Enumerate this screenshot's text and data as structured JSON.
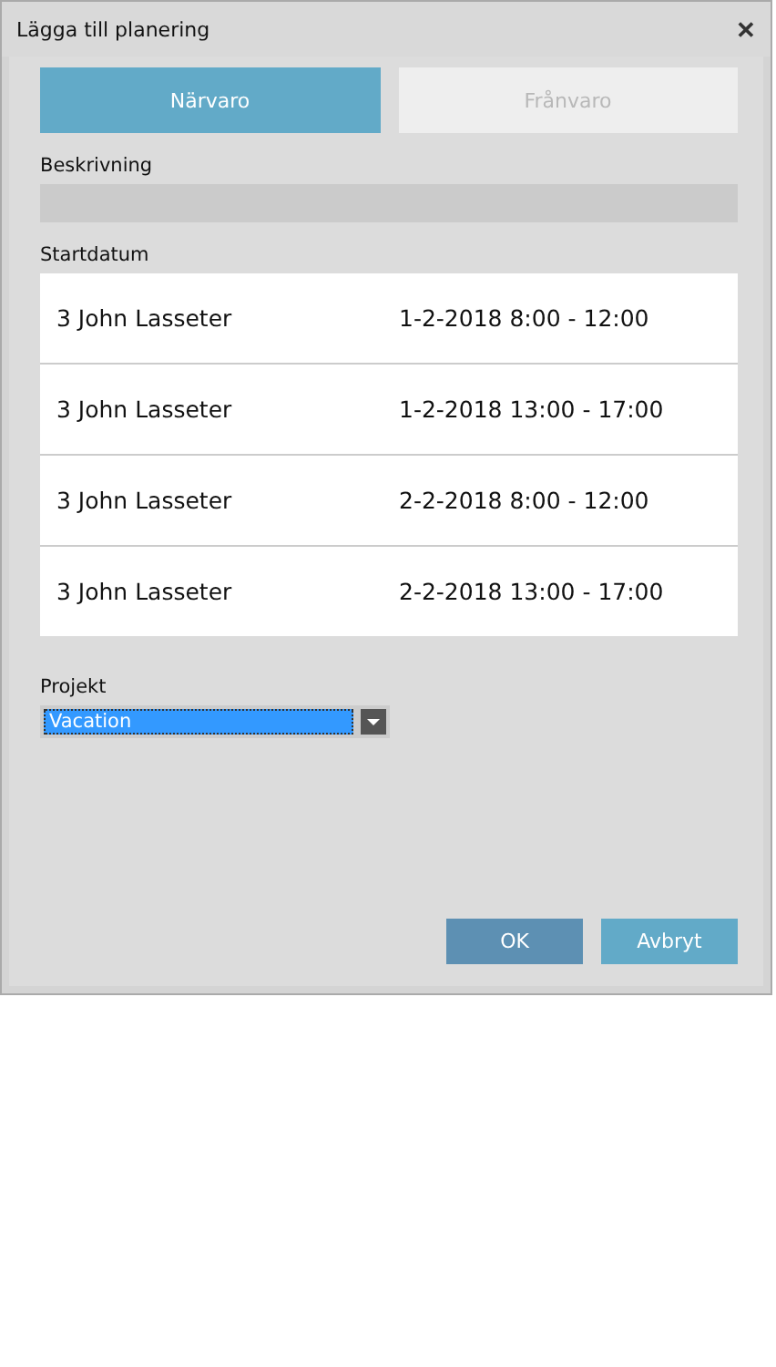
{
  "window": {
    "title": "Lägga till planering",
    "close": "✕"
  },
  "tabs": [
    {
      "label": "Närvaro",
      "selected": true
    },
    {
      "label": "Frånvaro",
      "selected": false
    }
  ],
  "description": {
    "label": "Beskrivning"
  },
  "start": {
    "label": "Startdatum",
    "rows": [
      {
        "name": "3 John Lasseter",
        "time": "1-2-2018 8:00 - 12:00"
      },
      {
        "name": "3 John Lasseter",
        "time": "1-2-2018 13:00 - 17:00"
      },
      {
        "name": "3 John Lasseter",
        "time": "2-2-2018 8:00 - 12:00"
      },
      {
        "name": "3 John Lasseter",
        "time": "2-2-2018 13:00 - 17:00"
      }
    ]
  },
  "project": {
    "label": "Projekt",
    "value": "Vacation"
  },
  "buttons": [
    {
      "label": "OK",
      "highlighted": true
    },
    {
      "label": "Avbryt",
      "highlighted": false
    }
  ]
}
